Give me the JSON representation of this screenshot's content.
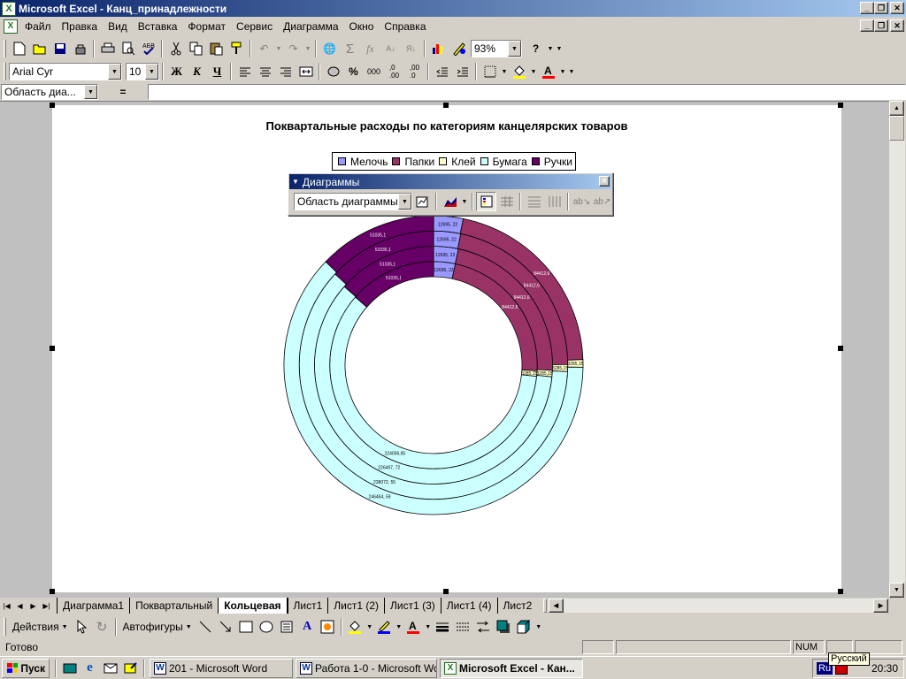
{
  "window": {
    "title": "Microsoft Excel - Канц_принадлежности"
  },
  "menu": [
    "Файл",
    "Правка",
    "Вид",
    "Вставка",
    "Формат",
    "Сервис",
    "Диаграмма",
    "Окно",
    "Справка"
  ],
  "toolbar": {
    "zoom": "93%"
  },
  "format_bar": {
    "font": "Arial Cyr",
    "size": "10",
    "bold": "Ж",
    "italic": "К",
    "underline": "Ч",
    "percent": "%",
    "thousands": "000"
  },
  "formula_bar": {
    "name_box": "Область диа...",
    "equals": "="
  },
  "chart_toolbar": {
    "title": "Диаграммы",
    "selector": "Область диаграммы"
  },
  "chart_data": {
    "type": "doughnut",
    "title": "Поквартальные расходы по категориям канцелярских товаров",
    "categories": [
      "Мелочь",
      "Папки",
      "Клей",
      "Бумага",
      "Ручки"
    ],
    "colors": [
      "#9999ff",
      "#993366",
      "#ffffcc",
      "#ccffff",
      "#660066"
    ],
    "series": [
      {
        "values": [
          12695.22,
          84412.6,
          3285.15,
          224056.95,
          51035.1
        ],
        "labels": [
          "12695, 22",
          "84412,6",
          "3285,15",
          "224056,95",
          "51035,1"
        ]
      },
      {
        "values": [
          12695.22,
          84412.6,
          3285.15,
          226497.72,
          51035.1
        ],
        "labels": [
          "12695, 22",
          "84412,6",
          "3285,15",
          "226497, 72",
          "51035,1"
        ]
      },
      {
        "values": [
          12695.22,
          84412.6,
          3285.15,
          238072.55,
          51035.1
        ],
        "labels": [
          "12695, 22",
          "84412,6",
          "3285,15",
          "238072, 55",
          "51035,1"
        ]
      },
      {
        "values": [
          12695.22,
          84412.6,
          3285.15,
          246464.59,
          51035.1
        ],
        "labels": [
          "12695, 22",
          "84412,6",
          "3285,15",
          "246464, 59",
          "51035,1"
        ]
      }
    ]
  },
  "sheet_tabs": [
    "Диаграмма1",
    "Поквартальный",
    "Кольцевая",
    "Лист1",
    "Лист1 (2)",
    "Лист1 (3)",
    "Лист1 (4)",
    "Лист2"
  ],
  "active_tab": "Кольцевая",
  "drawing_bar": {
    "actions": "Действия",
    "autoshapes": "Автофигуры"
  },
  "status": {
    "text": "Готово",
    "num": "NUM"
  },
  "taskbar": {
    "start": "Пуск",
    "tasks": [
      "201 - Microsoft Word",
      "Работа 1-0 - Microsoft Word",
      "Microsoft Excel - Кан..."
    ],
    "lang": "Ru",
    "tooltip": "Русский",
    "clock": "20:30"
  }
}
